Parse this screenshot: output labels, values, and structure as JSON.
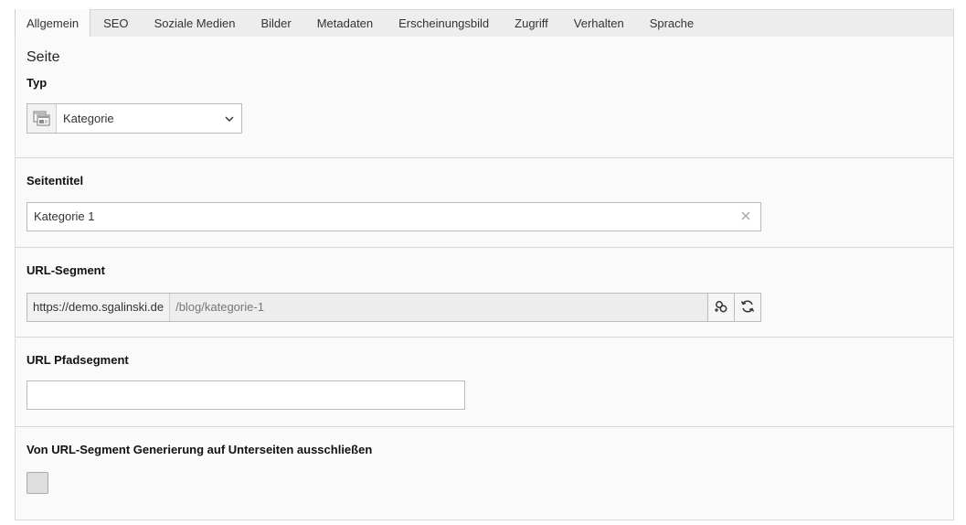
{
  "tabs": [
    {
      "label": "Allgemein",
      "active": true
    },
    {
      "label": "SEO"
    },
    {
      "label": "Soziale Medien"
    },
    {
      "label": "Bilder"
    },
    {
      "label": "Metadaten"
    },
    {
      "label": "Erscheinungsbild"
    },
    {
      "label": "Zugriff"
    },
    {
      "label": "Verhalten"
    },
    {
      "label": "Sprache"
    }
  ],
  "page_section": {
    "title": "Seite",
    "type_label": "Typ",
    "type_value": "Kategorie",
    "type_icon": "page-category-icon"
  },
  "page_title": {
    "label": "Seitentitel",
    "value": "Kategorie 1",
    "clear_icon": "close-icon"
  },
  "url_segment": {
    "label": "URL-Segment",
    "prefix": "https://demo.sgalinski.de",
    "value": "/blog/kategorie-1",
    "toggle_icon": "edit-toggle-icon",
    "refresh_icon": "refresh-icon"
  },
  "url_path_segment": {
    "label": "URL Pfadsegment",
    "value": ""
  },
  "exclude_subpages": {
    "label": "Von URL-Segment Generierung auf Unterseiten ausschließen",
    "checked": false
  }
}
